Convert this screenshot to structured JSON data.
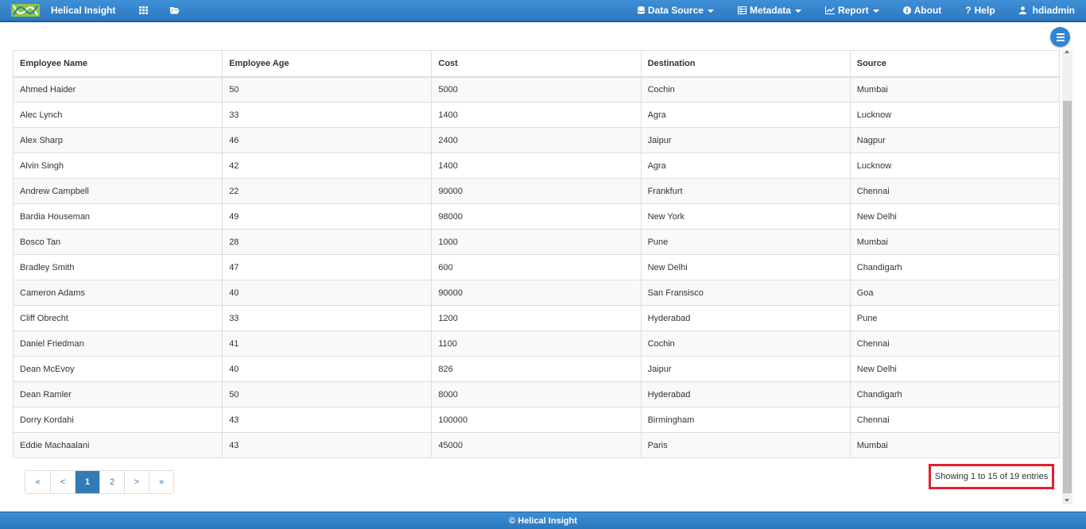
{
  "navbar": {
    "brand": "Helical Insight",
    "items": [
      {
        "label": "Data Source",
        "icon": "database-icon",
        "dropdown": true
      },
      {
        "label": "Metadata",
        "icon": "table-icon",
        "dropdown": true
      },
      {
        "label": "Report",
        "icon": "line-chart-icon",
        "dropdown": true
      },
      {
        "label": "About",
        "icon": "info-icon",
        "dropdown": false
      },
      {
        "label": "Help",
        "icon": "question-icon",
        "dropdown": false
      },
      {
        "label": "hdiadmin",
        "icon": "user-icon",
        "dropdown": false
      }
    ]
  },
  "table": {
    "headers": [
      "Employee Name",
      "Employee Age",
      "Cost",
      "Destination",
      "Source"
    ],
    "rows": [
      [
        "Ahmed Haider",
        "50",
        "5000",
        "Cochin",
        "Mumbai"
      ],
      [
        "Alec Lynch",
        "33",
        "1400",
        "Agra",
        "Lucknow"
      ],
      [
        "Alex Sharp",
        "46",
        "2400",
        "Jaipur",
        "Nagpur"
      ],
      [
        "Alvin Singh",
        "42",
        "1400",
        "Agra",
        "Lucknow"
      ],
      [
        "Andrew Campbell",
        "22",
        "90000",
        "Frankfurt",
        "Chennai"
      ],
      [
        "Bardia Houseman",
        "49",
        "98000",
        "New York",
        "New Delhi"
      ],
      [
        "Bosco Tan",
        "28",
        "1000",
        "Pune",
        "Mumbai"
      ],
      [
        "Bradley Smith",
        "47",
        "600",
        "New Delhi",
        "Chandigarh"
      ],
      [
        "Cameron Adams",
        "40",
        "90000",
        "San Fransisco",
        "Goa"
      ],
      [
        "Cliff Obrecht",
        "33",
        "1200",
        "Hyderabad",
        "Pune"
      ],
      [
        "Daniel Friedman",
        "41",
        "1100",
        "Cochin",
        "Chennai"
      ],
      [
        "Dean McEvoy",
        "40",
        "826",
        "Jaipur",
        "New Delhi"
      ],
      [
        "Dean Ramler",
        "50",
        "8000",
        "Hyderabad",
        "Chandigarh"
      ],
      [
        "Dorry Kordahi",
        "43",
        "100000",
        "Birmingham",
        "Chennai"
      ],
      [
        "Eddie Machaalani",
        "43",
        "45000",
        "Paris",
        "Mumbai"
      ]
    ]
  },
  "pagination": {
    "buttons": [
      "«",
      "<",
      "1",
      "2",
      ">",
      "»"
    ],
    "active": "1"
  },
  "info": "Showing 1 to 15 of 19 entries",
  "footer": "© Helical Insight",
  "colors": {
    "navbar": "#2f80c8",
    "highlight": "#e5202e",
    "active_page": "#337ab7"
  }
}
